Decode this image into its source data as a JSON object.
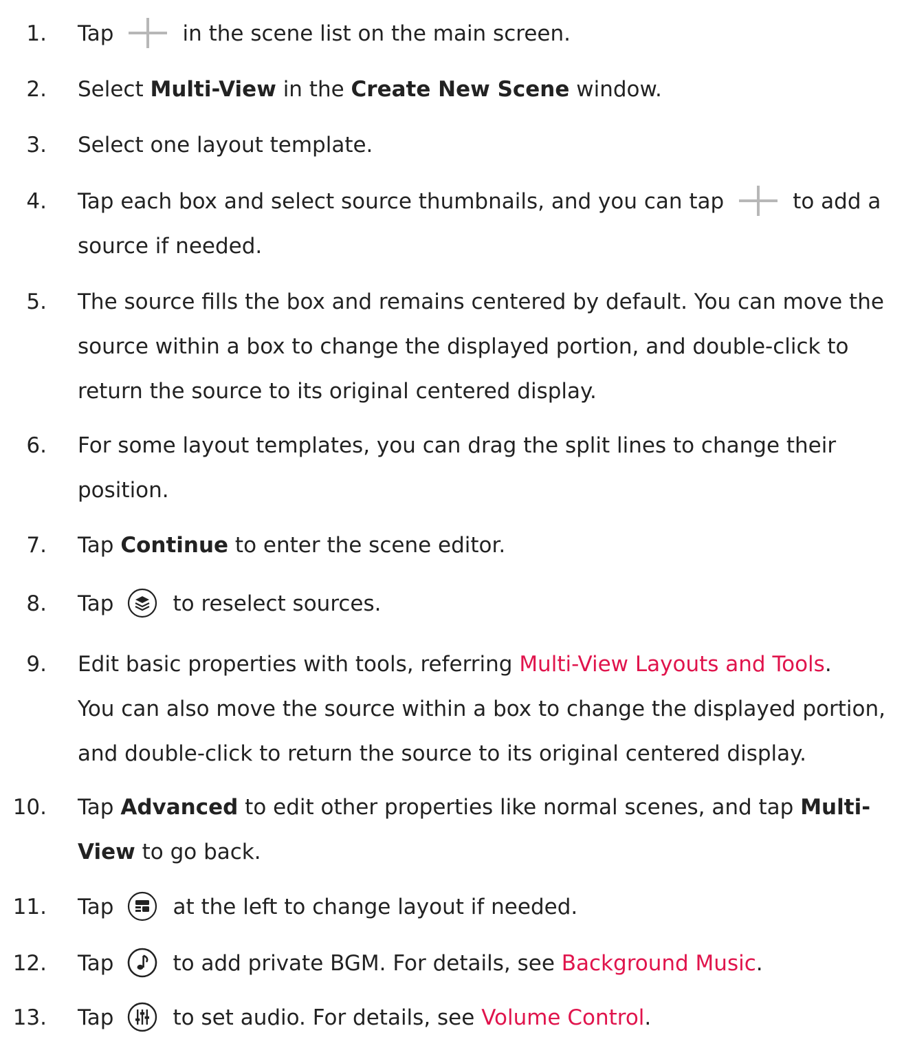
{
  "steps": [
    {
      "n": "1.",
      "a": "Tap",
      "b": "in the scene list on the main screen."
    },
    {
      "n": "2.",
      "a": "Select ",
      "bold1": "Multi-View",
      "b": " in the ",
      "bold2": "Create New Scene",
      "c": " window."
    },
    {
      "n": "3.",
      "a": "Select one layout template."
    },
    {
      "n": "4.",
      "a": "Tap each box and select source thumbnails, and you can tap",
      "b": "to add a",
      "c": "source if needed."
    },
    {
      "n": "5.",
      "a": "The source fills the box and remains centered by default. You can move the",
      "b": "source within a box to change the displayed portion, and double-click to",
      "c": "return the source to its original centered display."
    },
    {
      "n": "6.",
      "a": "For some layout templates, you can drag the split lines to change their",
      "b": "position."
    },
    {
      "n": "7.",
      "a": "Tap ",
      "bold1": "Continue",
      "b": " to enter the scene editor."
    },
    {
      "n": "8.",
      "a": "Tap",
      "b": "to reselect sources."
    },
    {
      "n": "9.",
      "a": "Edit basic properties with tools, referring ",
      "link": "Multi-View Layouts and Tools",
      "b": ".",
      "c": "You can also move the source within a box to change the displayed portion,",
      "d": "and double-click to return the source to its original centered display."
    },
    {
      "n": "10.",
      "a": "Tap ",
      "bold1": "Advanced",
      "b": " to edit other properties like normal scenes, and tap ",
      "bold2": "Multi-",
      "bold3": "View",
      "c": " to go back."
    },
    {
      "n": "11.",
      "a": "Tap",
      "b": "at the left to change layout if needed."
    },
    {
      "n": "12.",
      "a": "Tap",
      "b": "to add private BGM. For details, see ",
      "link": "Background Music",
      "c": "."
    },
    {
      "n": "13.",
      "a": "Tap",
      "b": "to set audio. For details, see ",
      "link": "Volume Control",
      "c": "."
    }
  ],
  "icons": {
    "plus": "plus-icon",
    "layers": "layers-icon",
    "layout": "layout-icon",
    "music": "music-note-icon",
    "mixer": "audio-mixer-icon"
  },
  "colors": {
    "text": "#222222",
    "link": "#e0144c",
    "icon_gray": "#b7b7b7"
  }
}
